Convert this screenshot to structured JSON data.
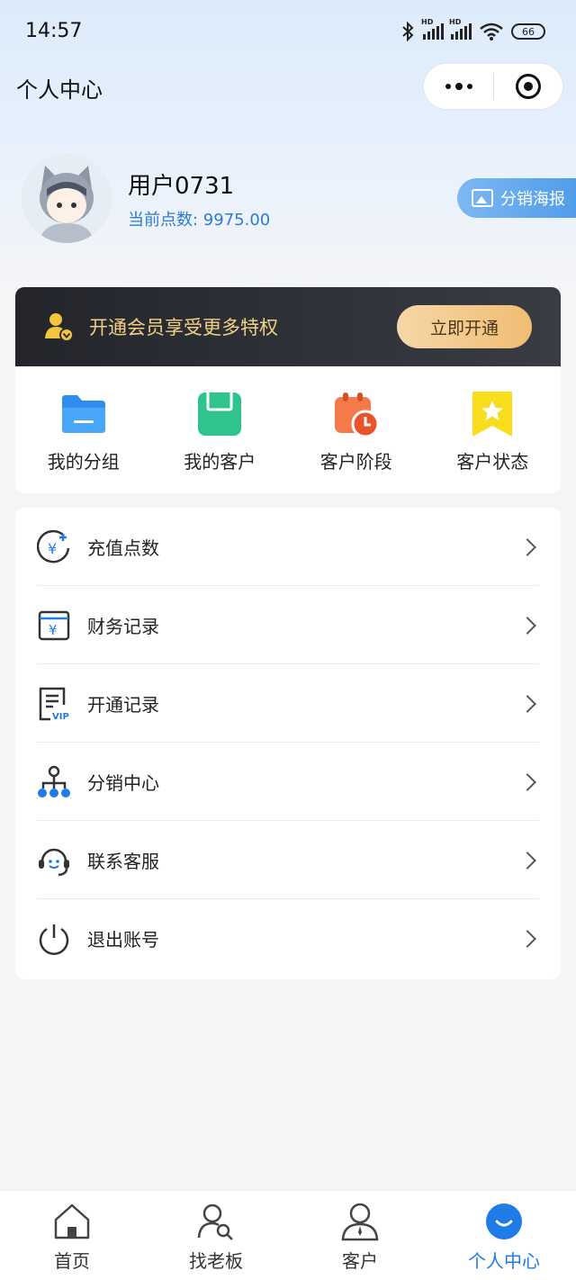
{
  "status_bar": {
    "time": "14:57",
    "battery": "66",
    "hd_label": "HD"
  },
  "header": {
    "title": "个人中心"
  },
  "profile": {
    "username": "用户0731",
    "points_label": "当前点数: 9975.00",
    "poster_button": "分销海报"
  },
  "vip_banner": {
    "text": "开通会员享受更多特权",
    "button": "立即开通"
  },
  "quick_links": [
    {
      "label": "我的分组",
      "icon": "folder-icon",
      "color": "#2f8df0"
    },
    {
      "label": "我的客户",
      "icon": "save-icon",
      "color": "#2fc48e"
    },
    {
      "label": "客户阶段",
      "icon": "calendar-clock-icon",
      "color": "#f06a3c"
    },
    {
      "label": "客户状态",
      "icon": "star-bookmark-icon",
      "color": "#f5d21b"
    }
  ],
  "menu": [
    {
      "label": "充值点数",
      "icon": "recharge-icon"
    },
    {
      "label": "财务记录",
      "icon": "finance-record-icon"
    },
    {
      "label": "开通记录",
      "icon": "vip-record-icon",
      "badge": "VIP"
    },
    {
      "label": "分销中心",
      "icon": "distribution-icon"
    },
    {
      "label": "联系客服",
      "icon": "customer-service-icon"
    },
    {
      "label": "退出账号",
      "icon": "power-icon"
    }
  ],
  "tabbar": [
    {
      "label": "首页",
      "icon": "home-icon",
      "active": false
    },
    {
      "label": "找老板",
      "icon": "find-boss-icon",
      "active": false
    },
    {
      "label": "客户",
      "icon": "customer-icon",
      "active": false
    },
    {
      "label": "个人中心",
      "icon": "profile-icon",
      "active": true
    }
  ],
  "colors": {
    "accent": "#1f7be6",
    "vip_gold": "#f2cf86",
    "points_blue": "#2d7bd8"
  }
}
